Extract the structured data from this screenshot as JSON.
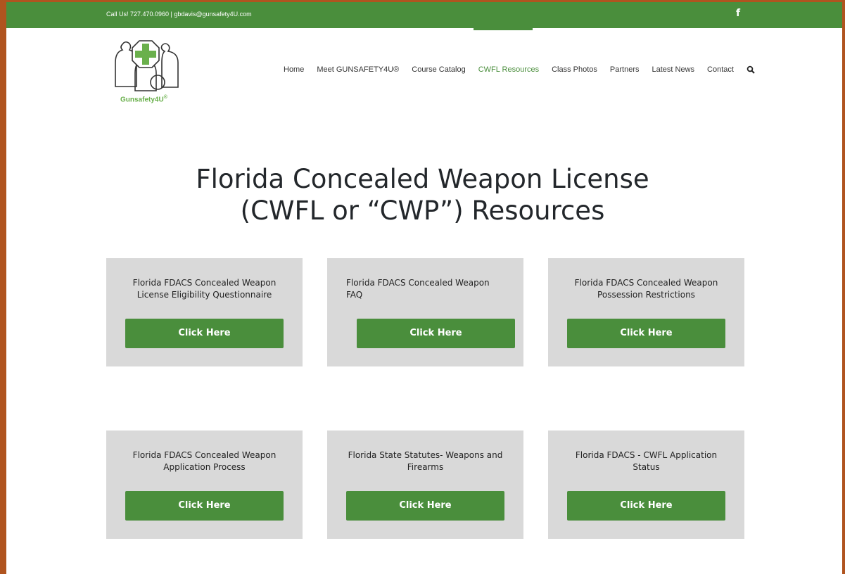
{
  "topbar": {
    "contact": "Call Us! 727.470.0960  |  gbdavis@gunsafety4U.com",
    "facebook_glyph": "f"
  },
  "logo": {
    "text": "Gunsafety4U",
    "mark": "®"
  },
  "nav": {
    "items": [
      {
        "label": "Home"
      },
      {
        "label": "Meet GUNSAFETY4U®"
      },
      {
        "label": "Course Catalog"
      },
      {
        "label": "CWFL Resources",
        "active": true
      },
      {
        "label": "Class Photos"
      },
      {
        "label": "Partners"
      },
      {
        "label": "Latest News"
      },
      {
        "label": "Contact"
      }
    ],
    "search_icon": "search-icon"
  },
  "page": {
    "title_line1": "Florida Concealed Weapon License",
    "title_line2": "(CWFL or “CWP”) Resources"
  },
  "cards": [
    {
      "title": "Florida FDACS Concealed Weapon License Eligibility Questionnaire",
      "button": "Click Here"
    },
    {
      "title": "Florida FDACS Concealed Weapon FAQ",
      "button": "Click Here"
    },
    {
      "title": "Florida FDACS Concealed Weapon Possession Restrictions",
      "button": "Click Here"
    },
    {
      "title": "Florida FDACS Concealed Weapon Application Process",
      "button": "Click Here"
    },
    {
      "title": "Florida State Statutes- Weapons and Firearms",
      "button": "Click Here"
    },
    {
      "title": "Florida FDACS - CWFL Application Status",
      "button": "Click Here"
    }
  ],
  "colors": {
    "brand_green": "#4a8e3c",
    "frame": "#b0541f",
    "card_bg": "#d9d9d9"
  }
}
